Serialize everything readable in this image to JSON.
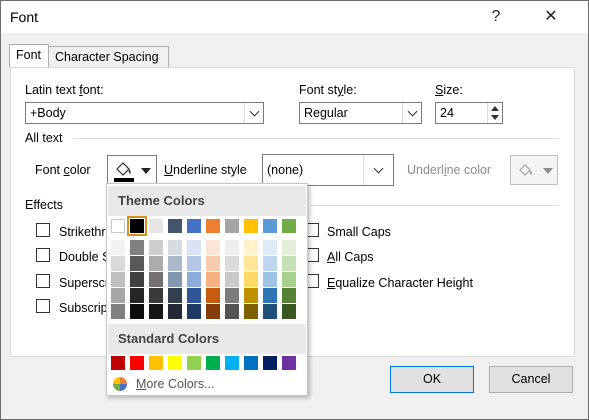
{
  "window": {
    "title": "Font",
    "help_label": "?",
    "close_label": "✕"
  },
  "tabs": [
    {
      "label": "Font"
    },
    {
      "label": "Character Spacing"
    }
  ],
  "font": {
    "latin_label_pre": "Latin text ",
    "latin_label_u": "f",
    "latin_label_post": "ont:",
    "latin_value": "+Body",
    "style_label_pre": "Font st",
    "style_label_u": "y",
    "style_label_post": "le:",
    "style_value": "Regular",
    "size_label_u": "S",
    "size_label_post": "ize:",
    "size_value": "24"
  },
  "all_text": {
    "section_label": "All text",
    "font_color_label_pre": "Font ",
    "font_color_label_u": "c",
    "font_color_label_post": "olor",
    "underline_style_label_u": "U",
    "underline_style_label_post": "nderline style",
    "underline_style_value": "(none)",
    "underline_color_label_pre": "Underl",
    "underline_color_label_u": "i",
    "underline_color_label_post": "ne color"
  },
  "effects": {
    "section_label": "Effects",
    "left": [
      {
        "u": "",
        "rest": "Strikethr"
      },
      {
        "u": "",
        "rest": "Double S"
      },
      {
        "u": "",
        "rest": "Superscr"
      },
      {
        "u": "",
        "rest": "Subscrip"
      }
    ],
    "right": [
      {
        "u": "",
        "rest": "Small Caps"
      },
      {
        "u": "A",
        "rest": "ll Caps"
      },
      {
        "u": "E",
        "rest": "qualize Character Height"
      }
    ]
  },
  "buttons": {
    "ok": "OK",
    "cancel": "Cancel"
  },
  "color_menu": {
    "theme_label": "Theme Colors",
    "standard_label": "Standard Colors",
    "more_label_u": "M",
    "more_label_post": "ore Colors...",
    "theme_top": [
      "#ffffff",
      "#000000",
      "#e7e6e6",
      "#44546a",
      "#4472c4",
      "#ed7d31",
      "#a5a5a5",
      "#ffc000",
      "#5b9bd5",
      "#70ad47"
    ],
    "theme_shades": [
      [
        "#f2f2f2",
        "#d9d9d9",
        "#bfbfbf",
        "#a6a6a6",
        "#808080"
      ],
      [
        "#808080",
        "#595959",
        "#404040",
        "#262626",
        "#0d0d0d"
      ],
      [
        "#d0cece",
        "#aeabab",
        "#757070",
        "#3a3838",
        "#171616"
      ],
      [
        "#d6dce4",
        "#adb9ca",
        "#8497b0",
        "#333f4f",
        "#222a35"
      ],
      [
        "#dae3f3",
        "#b4c7e7",
        "#8faadc",
        "#2f5597",
        "#1f3864"
      ],
      [
        "#fbe5d6",
        "#f8cbad",
        "#f4b183",
        "#c55a11",
        "#843c0c"
      ],
      [
        "#ededed",
        "#dbdbdb",
        "#c9c9c9",
        "#7b7b7b",
        "#525252"
      ],
      [
        "#fff2cc",
        "#ffe699",
        "#ffd966",
        "#bf9000",
        "#7f6000"
      ],
      [
        "#deebf7",
        "#bdd7ee",
        "#9dc3e6",
        "#2e75b6",
        "#1f4e79"
      ],
      [
        "#e2f0d9",
        "#c5e0b4",
        "#a9d18e",
        "#548235",
        "#385723"
      ]
    ],
    "standard": [
      "#c00000",
      "#ff0000",
      "#ffc000",
      "#ffff00",
      "#92d050",
      "#00b050",
      "#00b0f0",
      "#0070c0",
      "#002060",
      "#7030a0"
    ]
  }
}
